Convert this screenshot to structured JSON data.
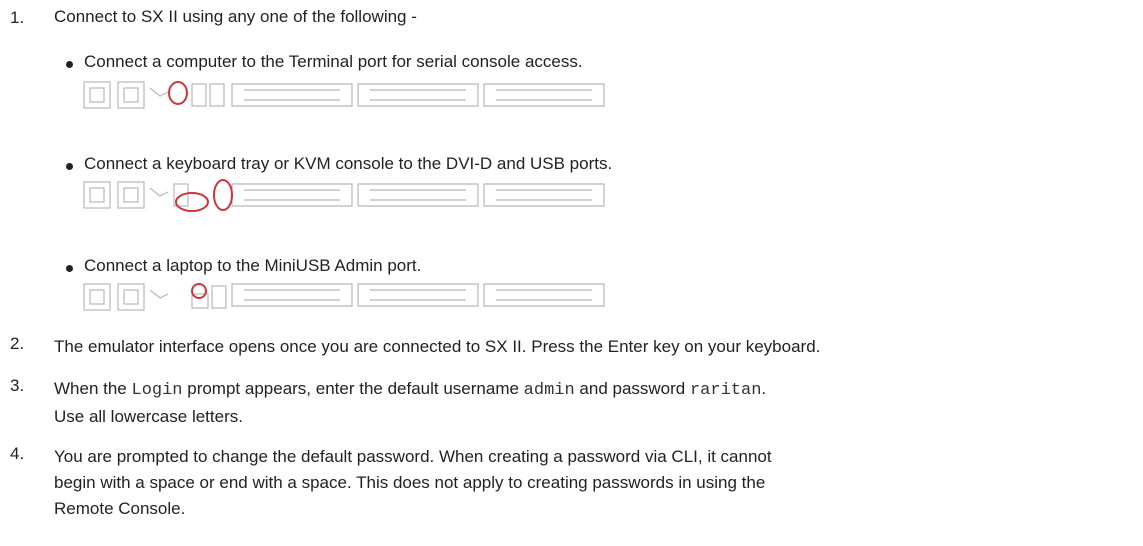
{
  "steps": [
    {
      "number": "1.",
      "text": "Connect to SX II using any one of the following -"
    },
    {
      "number": "2.",
      "text": "The emulator interface opens once you are connected to SX II. Press the Enter key on your keyboard."
    },
    {
      "number": "3.",
      "text_a": "When the ",
      "code_a": "Login",
      "text_b": " prompt appears, enter the default username ",
      "code_b": "admin",
      "text_c": " and password ",
      "code_c": "raritan",
      "text_d": ".",
      "line2": "Use all lowercase letters."
    },
    {
      "number": "4.",
      "line1": "You are prompted to change the default password. When creating a password via CLI, it cannot",
      "line2": "begin with a space or end with a space. This does not apply to creating passwords in using the",
      "line3": "Remote Console."
    }
  ],
  "bullets": [
    {
      "text": "Connect a computer to the Terminal port for serial console access.",
      "highlight": "terminal-port"
    },
    {
      "text": "Connect a keyboard tray or KVM console to the DVI-D and USB ports.",
      "highlight": "dvi-usb-ports"
    },
    {
      "text": "Connect a laptop to the MiniUSB Admin port.",
      "highlight": "miniusb-port"
    }
  ],
  "colors": {
    "text": "#222222",
    "highlight": "#d0343c",
    "diagram": "#b8b8b8"
  }
}
